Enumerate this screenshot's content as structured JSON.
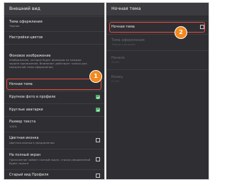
{
  "left": {
    "title": "Внешний вид",
    "items": [
      {
        "title": "Тема оформления",
        "subtitle": "Черная"
      },
      {
        "title": "Настройки цветов"
      },
      {
        "title": "Фоновое изображение",
        "subtitle": "Изображение, которое будет фоновым на каждом экране приложения. Внимание: действует только для прозрачной темы оформления"
      },
      {
        "title": "Ночная тема",
        "checked": false
      },
      {
        "title": "Крупное фото в профиле",
        "checked": true
      },
      {
        "title": "Круглые аватарки",
        "checked": true
      },
      {
        "title": "Размер текста",
        "subtitle": "100%"
      },
      {
        "title": "Цветная иконка",
        "subtitle": "Цветная иконка в уведомлении",
        "checked": false
      },
      {
        "title": "На полный экран",
        "subtitle": "Приложение займет полный экран, строка уведомлений будет скрыта",
        "checked": false
      },
      {
        "title": "Старый вид Профиля",
        "checked": false
      }
    ],
    "badge": "1"
  },
  "right": {
    "title": "Ночная тема",
    "items": [
      {
        "title": "Ночная тема",
        "checked": false
      },
      {
        "title": "Тема оформления",
        "subtitle": "Тёмного режима",
        "disabled": true
      },
      {
        "title": "Начало",
        "subtitle": "22:00",
        "disabled": true
      },
      {
        "title": "Конец",
        "subtitle": "07:00",
        "disabled": true
      }
    ],
    "badge": "2"
  },
  "colors": {
    "background": "#2f2f33",
    "appbar": "#3b3b40",
    "highlight": "#e84c3d",
    "badge": "#f28a1f",
    "checkbox_on": "#4caf68"
  }
}
